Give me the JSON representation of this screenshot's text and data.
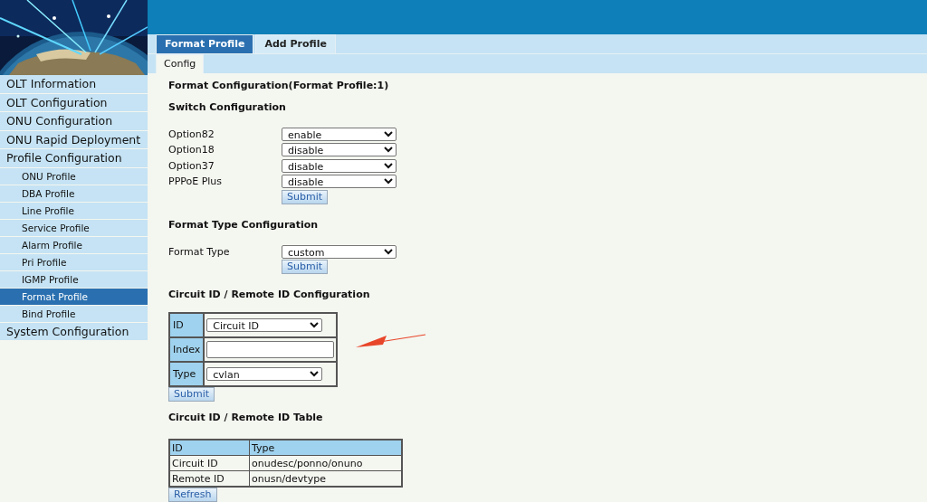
{
  "sidebar": {
    "items": [
      {
        "label": "OLT Information",
        "selected": false
      },
      {
        "label": "OLT Configuration",
        "selected": false
      },
      {
        "label": "ONU Configuration",
        "selected": false
      },
      {
        "label": "ONU Rapid Deployment",
        "selected": false
      },
      {
        "label": "Profile Configuration",
        "selected": false,
        "children": [
          {
            "label": "ONU Profile",
            "selected": false
          },
          {
            "label": "DBA Profile",
            "selected": false
          },
          {
            "label": "Line Profile",
            "selected": false
          },
          {
            "label": "Service Profile",
            "selected": false
          },
          {
            "label": "Alarm Profile",
            "selected": false
          },
          {
            "label": "Pri Profile",
            "selected": false
          },
          {
            "label": "IGMP Profile",
            "selected": false
          },
          {
            "label": "Format Profile",
            "selected": true
          },
          {
            "label": "Bind Profile",
            "selected": false
          }
        ]
      },
      {
        "label": "System Configuration",
        "selected": false
      }
    ]
  },
  "tabs": [
    {
      "label": "Format Profile",
      "selected": true
    },
    {
      "label": "Add Profile",
      "selected": false
    }
  ],
  "subtabs": [
    {
      "label": "Config",
      "selected": true
    }
  ],
  "page_title": "Format Configuration(Format Profile:1)",
  "switch_section": {
    "title": "Switch Configuration",
    "fields": [
      {
        "label": "Option82",
        "value": "enable"
      },
      {
        "label": "Option18",
        "value": "disable"
      },
      {
        "label": "Option37",
        "value": "disable"
      },
      {
        "label": "PPPoE Plus",
        "value": "disable"
      }
    ],
    "button": "Submit"
  },
  "format_type_section": {
    "title": "Format Type Configuration",
    "fields": [
      {
        "label": "Format Type",
        "value": "custom"
      }
    ],
    "button": "Submit"
  },
  "circuit_config": {
    "title": "Circuit ID / Remote ID Configuration",
    "fields": [
      {
        "label": "ID",
        "kind": "select",
        "value": "Circuit ID"
      },
      {
        "label": "Index",
        "kind": "input"
      },
      {
        "label": "Type",
        "kind": "select",
        "value": "cvlan"
      }
    ],
    "button": "Submit"
  },
  "circuit_table": {
    "title": "Circuit ID / Remote ID Table",
    "columns": [
      "ID",
      "Type"
    ],
    "rows": [
      [
        "Circuit ID",
        "onudesc/ponno/onuno"
      ],
      [
        "Remote ID",
        "onusn/devtype"
      ]
    ],
    "button": "Refresh"
  },
  "annotation": {
    "kind": "arrow"
  }
}
